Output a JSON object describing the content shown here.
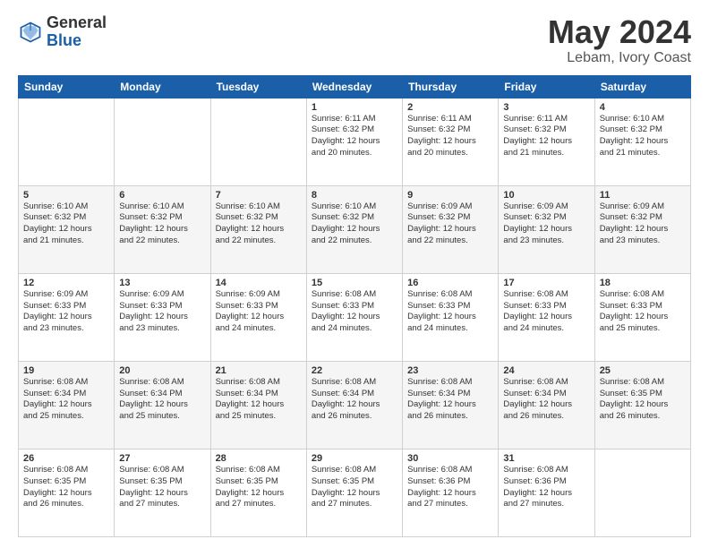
{
  "header": {
    "logo_general": "General",
    "logo_blue": "Blue",
    "month_title": "May 2024",
    "location": "Lebam, Ivory Coast"
  },
  "days_of_week": [
    "Sunday",
    "Monday",
    "Tuesday",
    "Wednesday",
    "Thursday",
    "Friday",
    "Saturday"
  ],
  "weeks": [
    [
      {
        "num": "",
        "info": ""
      },
      {
        "num": "",
        "info": ""
      },
      {
        "num": "",
        "info": ""
      },
      {
        "num": "1",
        "info": "Sunrise: 6:11 AM\nSunset: 6:32 PM\nDaylight: 12 hours\nand 20 minutes."
      },
      {
        "num": "2",
        "info": "Sunrise: 6:11 AM\nSunset: 6:32 PM\nDaylight: 12 hours\nand 20 minutes."
      },
      {
        "num": "3",
        "info": "Sunrise: 6:11 AM\nSunset: 6:32 PM\nDaylight: 12 hours\nand 21 minutes."
      },
      {
        "num": "4",
        "info": "Sunrise: 6:10 AM\nSunset: 6:32 PM\nDaylight: 12 hours\nand 21 minutes."
      }
    ],
    [
      {
        "num": "5",
        "info": "Sunrise: 6:10 AM\nSunset: 6:32 PM\nDaylight: 12 hours\nand 21 minutes."
      },
      {
        "num": "6",
        "info": "Sunrise: 6:10 AM\nSunset: 6:32 PM\nDaylight: 12 hours\nand 22 minutes."
      },
      {
        "num": "7",
        "info": "Sunrise: 6:10 AM\nSunset: 6:32 PM\nDaylight: 12 hours\nand 22 minutes."
      },
      {
        "num": "8",
        "info": "Sunrise: 6:10 AM\nSunset: 6:32 PM\nDaylight: 12 hours\nand 22 minutes."
      },
      {
        "num": "9",
        "info": "Sunrise: 6:09 AM\nSunset: 6:32 PM\nDaylight: 12 hours\nand 22 minutes."
      },
      {
        "num": "10",
        "info": "Sunrise: 6:09 AM\nSunset: 6:32 PM\nDaylight: 12 hours\nand 23 minutes."
      },
      {
        "num": "11",
        "info": "Sunrise: 6:09 AM\nSunset: 6:32 PM\nDaylight: 12 hours\nand 23 minutes."
      }
    ],
    [
      {
        "num": "12",
        "info": "Sunrise: 6:09 AM\nSunset: 6:33 PM\nDaylight: 12 hours\nand 23 minutes."
      },
      {
        "num": "13",
        "info": "Sunrise: 6:09 AM\nSunset: 6:33 PM\nDaylight: 12 hours\nand 23 minutes."
      },
      {
        "num": "14",
        "info": "Sunrise: 6:09 AM\nSunset: 6:33 PM\nDaylight: 12 hours\nand 24 minutes."
      },
      {
        "num": "15",
        "info": "Sunrise: 6:08 AM\nSunset: 6:33 PM\nDaylight: 12 hours\nand 24 minutes."
      },
      {
        "num": "16",
        "info": "Sunrise: 6:08 AM\nSunset: 6:33 PM\nDaylight: 12 hours\nand 24 minutes."
      },
      {
        "num": "17",
        "info": "Sunrise: 6:08 AM\nSunset: 6:33 PM\nDaylight: 12 hours\nand 24 minutes."
      },
      {
        "num": "18",
        "info": "Sunrise: 6:08 AM\nSunset: 6:33 PM\nDaylight: 12 hours\nand 25 minutes."
      }
    ],
    [
      {
        "num": "19",
        "info": "Sunrise: 6:08 AM\nSunset: 6:34 PM\nDaylight: 12 hours\nand 25 minutes."
      },
      {
        "num": "20",
        "info": "Sunrise: 6:08 AM\nSunset: 6:34 PM\nDaylight: 12 hours\nand 25 minutes."
      },
      {
        "num": "21",
        "info": "Sunrise: 6:08 AM\nSunset: 6:34 PM\nDaylight: 12 hours\nand 25 minutes."
      },
      {
        "num": "22",
        "info": "Sunrise: 6:08 AM\nSunset: 6:34 PM\nDaylight: 12 hours\nand 26 minutes."
      },
      {
        "num": "23",
        "info": "Sunrise: 6:08 AM\nSunset: 6:34 PM\nDaylight: 12 hours\nand 26 minutes."
      },
      {
        "num": "24",
        "info": "Sunrise: 6:08 AM\nSunset: 6:34 PM\nDaylight: 12 hours\nand 26 minutes."
      },
      {
        "num": "25",
        "info": "Sunrise: 6:08 AM\nSunset: 6:35 PM\nDaylight: 12 hours\nand 26 minutes."
      }
    ],
    [
      {
        "num": "26",
        "info": "Sunrise: 6:08 AM\nSunset: 6:35 PM\nDaylight: 12 hours\nand 26 minutes."
      },
      {
        "num": "27",
        "info": "Sunrise: 6:08 AM\nSunset: 6:35 PM\nDaylight: 12 hours\nand 27 minutes."
      },
      {
        "num": "28",
        "info": "Sunrise: 6:08 AM\nSunset: 6:35 PM\nDaylight: 12 hours\nand 27 minutes."
      },
      {
        "num": "29",
        "info": "Sunrise: 6:08 AM\nSunset: 6:35 PM\nDaylight: 12 hours\nand 27 minutes."
      },
      {
        "num": "30",
        "info": "Sunrise: 6:08 AM\nSunset: 6:36 PM\nDaylight: 12 hours\nand 27 minutes."
      },
      {
        "num": "31",
        "info": "Sunrise: 6:08 AM\nSunset: 6:36 PM\nDaylight: 12 hours\nand 27 minutes."
      },
      {
        "num": "",
        "info": ""
      }
    ]
  ]
}
